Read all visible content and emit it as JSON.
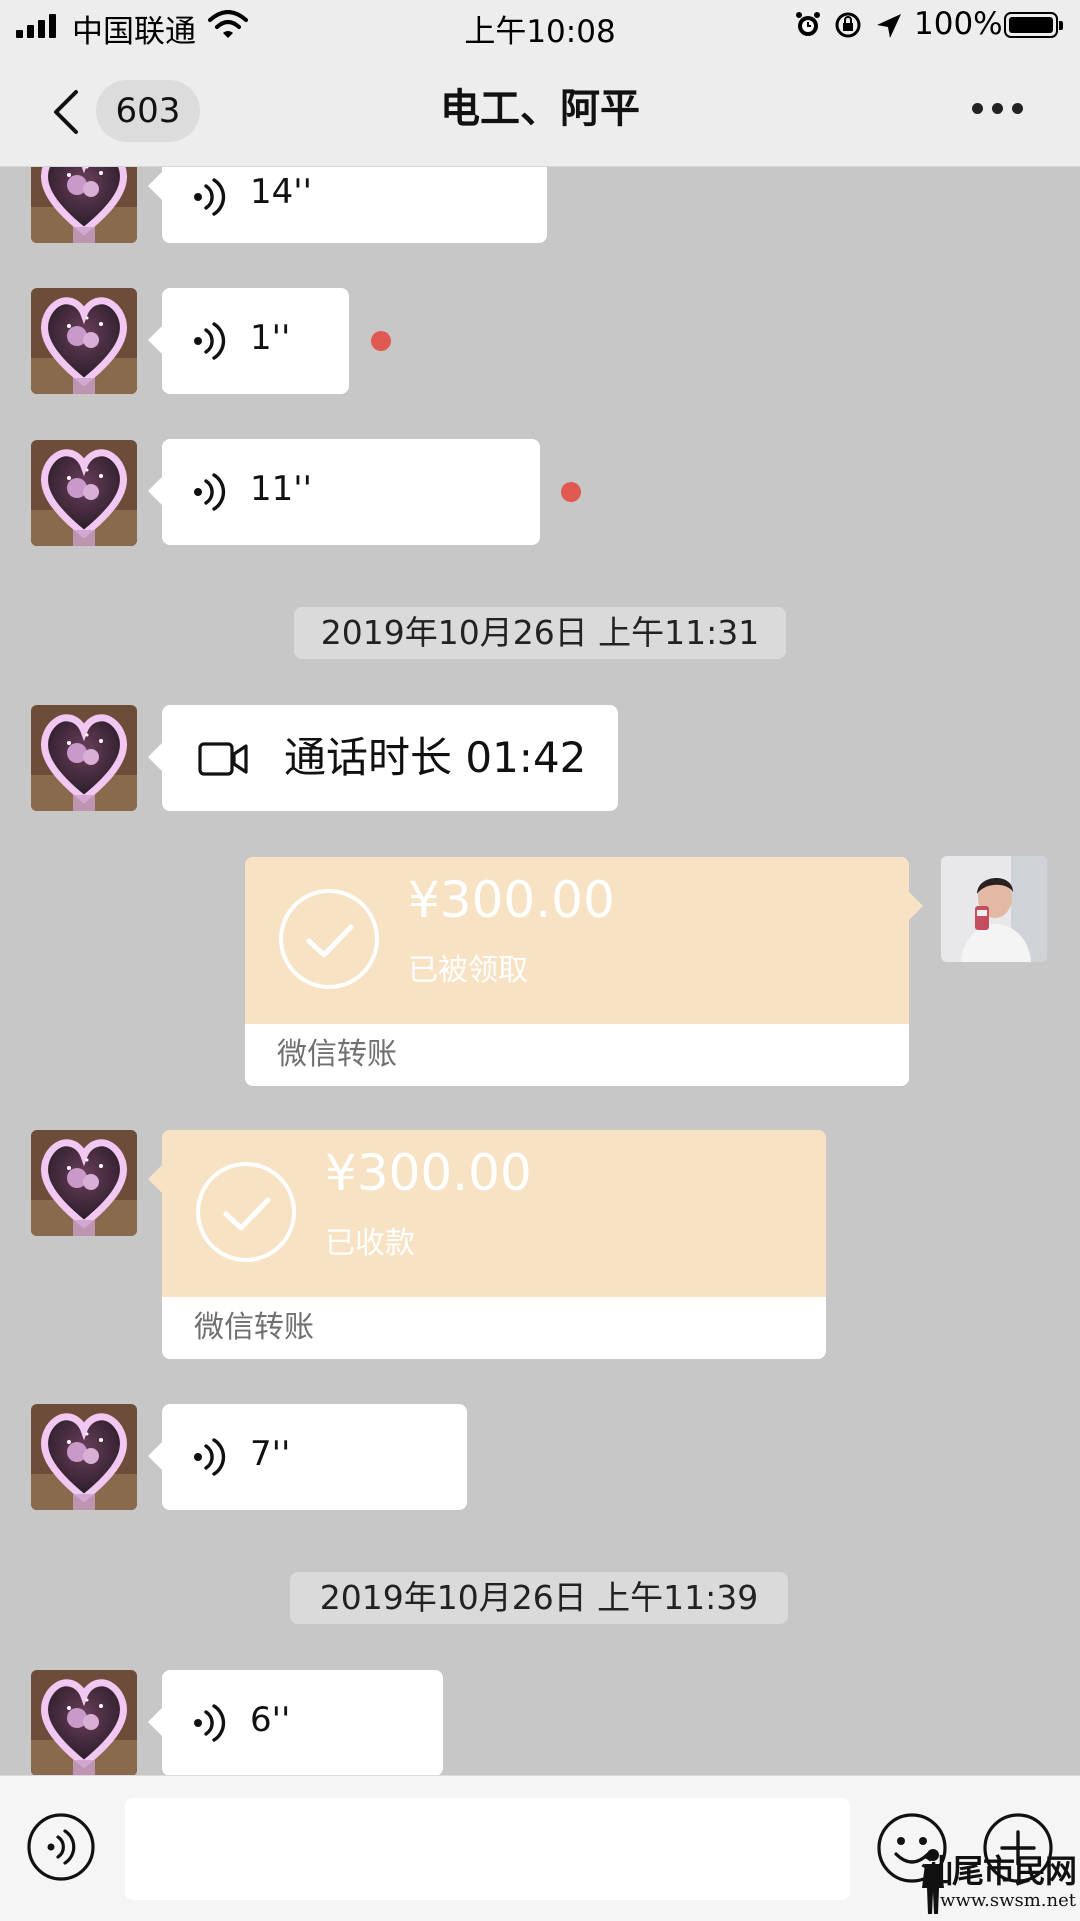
{
  "status_bar": {
    "carrier": "中国联通",
    "time": "上午10:08",
    "battery_percent": "100%",
    "battery_level": 1.0,
    "icons": [
      "signal-icon",
      "wifi-icon",
      "alarm-icon",
      "rotation-lock-icon",
      "location-icon",
      "battery-icon"
    ]
  },
  "nav": {
    "unread_count": "603",
    "title": "电工、阿平",
    "icons": [
      "back-chevron-icon",
      "more-dots-icon"
    ]
  },
  "messages": {
    "voice_1": {
      "duration": "14''"
    },
    "voice_2": {
      "duration": "1''"
    },
    "voice_3": {
      "duration": "11''"
    },
    "timestamp_1": "2019年10月26日 上午11:31",
    "video_call": {
      "text": "通话时长 01:42",
      "icon": "video-camera-icon"
    },
    "transfer_sent": {
      "amount": "¥300.00",
      "status": "已被领取",
      "label": "微信转账",
      "icon": "check-circle-icon"
    },
    "transfer_received": {
      "amount": "¥300.00",
      "status": "已收款",
      "label": "微信转账",
      "icon": "check-circle-icon"
    },
    "voice_4": {
      "duration": "7''"
    },
    "timestamp_2": "2019年10月26日 上午11:39",
    "voice_5": {
      "duration": "6''"
    }
  },
  "input_bar": {
    "icons": [
      "voice-mode-icon",
      "emoji-icon",
      "plus-icon"
    ]
  },
  "watermark": {
    "text": "汕尾市民网",
    "url": "www.swsm.net"
  },
  "colors": {
    "chat_background": "#c7c7c7",
    "bar_background": "#ededed",
    "transfer_accent": "#f8e2c4",
    "unread_dot": "#e05a52"
  }
}
